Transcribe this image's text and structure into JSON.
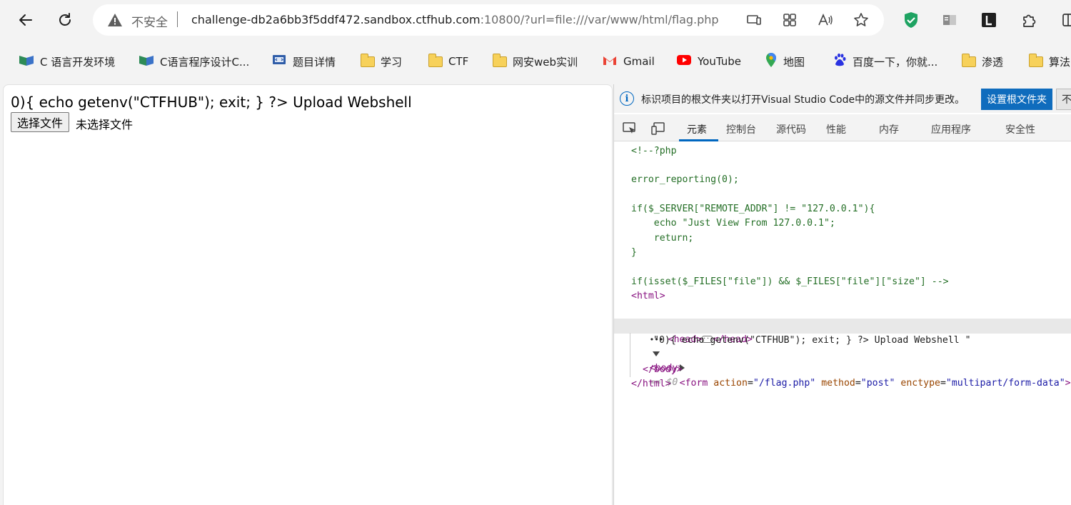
{
  "toolbar": {
    "insecure_label": "不安全",
    "url_host": "challenge-db2a6bb3f5ddf472.sandbox.ctfhub.com",
    "url_path": ":10800/?url=file:///var/www/html/flag.php",
    "icons": [
      "back-icon",
      "refresh-icon",
      "warning-icon",
      "device-icon",
      "apps-icon",
      "read-aloud-icon",
      "favorite-star-icon",
      "shield-extension-icon",
      "book-extension-icon",
      "l-extension-icon",
      "puzzle-extensions-icon",
      "split-screen-icon"
    ]
  },
  "bookmarks": [
    {
      "label": "C 语言开发环境",
      "icon": "book-icon"
    },
    {
      "label": "C语言程序设计C...",
      "icon": "book-icon"
    },
    {
      "label": "题目详情",
      "icon": "page-icon"
    },
    {
      "label": "学习",
      "icon": "folder-icon"
    },
    {
      "label": "CTF",
      "icon": "folder-icon"
    },
    {
      "label": "网安web实训",
      "icon": "folder-icon"
    },
    {
      "label": "Gmail",
      "icon": "gmail-icon"
    },
    {
      "label": "YouTube",
      "icon": "youtube-icon"
    },
    {
      "label": "地图",
      "icon": "maps-pin-icon"
    },
    {
      "label": "百度一下，你就...",
      "icon": "baidu-paw-icon"
    },
    {
      "label": "渗透",
      "icon": "folder-icon"
    },
    {
      "label": "算法",
      "icon": "folder-icon"
    }
  ],
  "page": {
    "text_line": "0){ echo getenv(\"CTFHUB\"); exit; } ?> Upload Webshell",
    "choose_file_button": "选择文件",
    "no_file_text": "未选择文件"
  },
  "devtools": {
    "infobar_message": "标识项目的根文件夹以打开Visual Studio Code中的源文件并同步更改。",
    "set_root_button": "设置根文件夹",
    "never_button": "不再",
    "tabs": [
      "元素",
      "控制台",
      "源代码",
      "性能",
      "内存",
      "应用程序",
      "安全性"
    ],
    "active_tab": "元素",
    "code": {
      "c1": "<!--?php",
      "c2": "error_reporting(0);",
      "c3": "if($_SERVER[\"REMOTE_ADDR\"] != \"127.0.0.1\"){",
      "c4": "    echo \"Just View From 127.0.0.1\";",
      "c5": "    return;",
      "c6": "}",
      "c7": "if(isset($_FILES[\"file\"]) && $_FILES[\"file\"][\"size\"] -->",
      "html_open": "<html>",
      "head_open": "<head>",
      "head_close": "</head>",
      "body_open": "<body>",
      "body_sel": "== $0",
      "body_text": "\"0){ echo getenv(\"CTFHUB\"); exit; } ?> Upload Webshell \"",
      "form_tag": "<form",
      "form_attr1_name": "action",
      "form_attr1_val": "\"/flag.php\"",
      "form_attr2_name": "method",
      "form_attr2_val": "\"post\"",
      "form_attr3_name": "enctype",
      "form_attr3_val": "\"multipart/form-data\"",
      "form_end": ">",
      "body_close": "</body>",
      "html_close": "</html>",
      "dots": "•••"
    }
  }
}
